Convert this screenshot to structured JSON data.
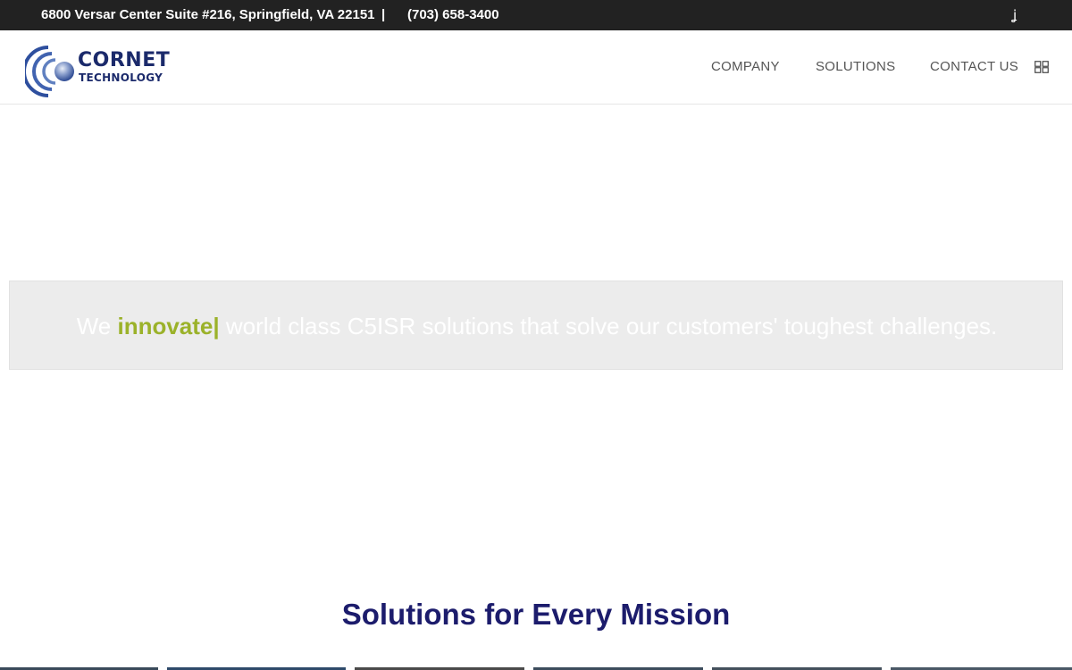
{
  "topbar": {
    "address": "6800 Versar Center Suite #216, Springfield, VA 22151",
    "separator": "|",
    "phone": "(703) 658-3400",
    "social_icon": "instagram-icon"
  },
  "header": {
    "logo": {
      "name": "CORNET",
      "subtitle": "TECHNOLOGY"
    },
    "nav": {
      "company": "COMPANY",
      "solutions": "SOLUTIONS",
      "contact": "CONTACT US"
    },
    "menu_icon": "grid-menu-icon"
  },
  "hero": {
    "prefix": "We ",
    "highlight": "innovate",
    "cursor": "|",
    "suffix": " world class C5ISR solutions that solve our customers' toughest challenges."
  },
  "section": {
    "title": "Solutions for Every Mission"
  },
  "colors": {
    "topbar_bg": "#222222",
    "brand_navy": "#1b2a6b",
    "accent_green": "#9bb22a",
    "heading_navy": "#1c1c6c",
    "hero_band": "#ececec"
  }
}
